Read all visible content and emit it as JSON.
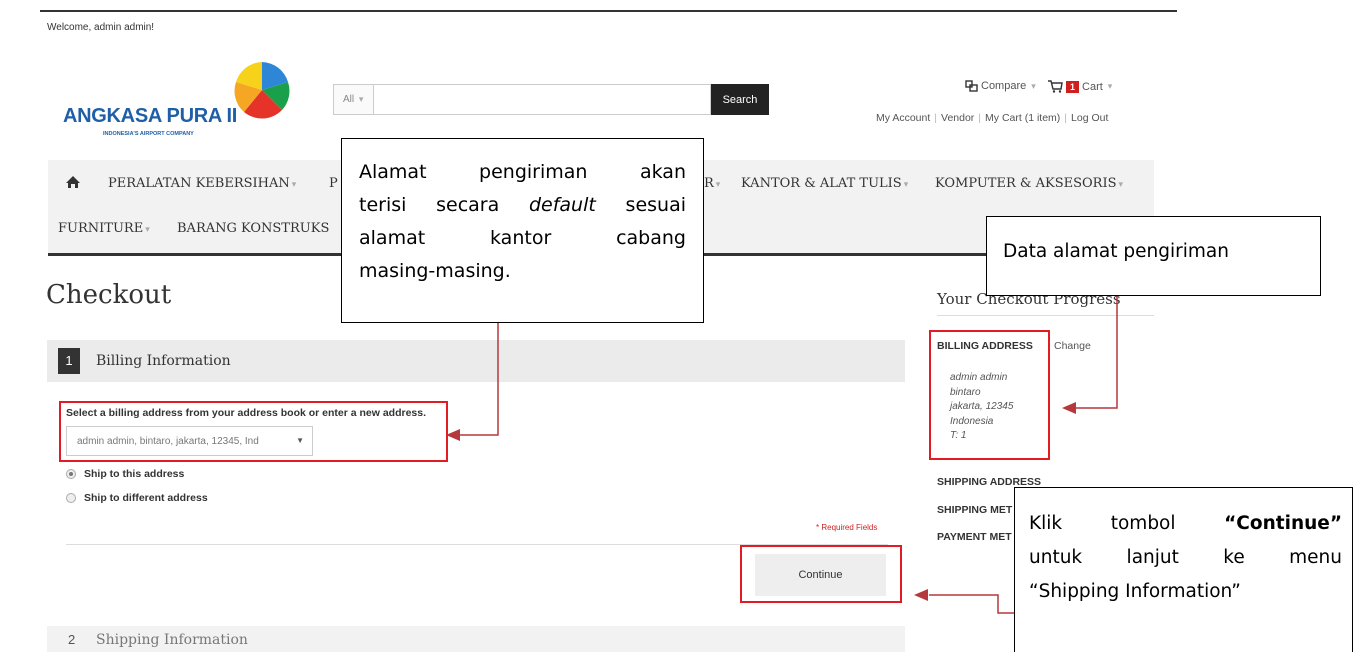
{
  "header": {
    "welcome": "Welcome, admin admin!",
    "logo_text": "ANGKASA PURA II",
    "logo_subtitle": "INDONESIA'S AIRPORT COMPANY",
    "search_category": "All",
    "search_value": "",
    "search_button": "Search",
    "compare_label": "Compare",
    "cart_count": "1",
    "cart_label": "Cart",
    "account_links": [
      "My Account",
      "Vendor",
      "My Cart (1 item)",
      "Log Out"
    ]
  },
  "nav": {
    "row1": [
      "PERALATAN KEBERSIHAN",
      "P",
      "R",
      "KANTOR & ALAT TULIS",
      "KOMPUTER & AKSESORIS"
    ],
    "row2": [
      "FURNITURE",
      "BARANG KONSTRUKS"
    ]
  },
  "checkout": {
    "title": "Checkout",
    "step1_number": "1",
    "step1_title": "Billing Information",
    "select_label": "Select a billing address from your address book or enter a new address.",
    "selected_address": "admin admin, bintaro, jakarta, 12345, Ind",
    "ship_same": "Ship to this address",
    "ship_different": "Ship to different address",
    "required_fields": "* Required Fields",
    "continue_button": "Continue",
    "step2_number": "2",
    "step2_title": "Shipping Information"
  },
  "progress": {
    "title": "Your Checkout Progress",
    "billing_head": "BILLING ADDRESS",
    "change_link": "Change",
    "billing_lines": [
      "admin admin",
      "bintaro",
      "jakarta, 12345",
      "Indonesia",
      "T: 1"
    ],
    "shipping_address_head": "SHIPPING ADDRESS",
    "shipping_method_head": "SHIPPING MET",
    "payment_method_head": "PAYMENT MET"
  },
  "callouts": {
    "c1_lines": [
      "Alamat pengiriman akan",
      "terisi secara",
      "default",
      "sesuai",
      "alamat kantor cabang",
      "masing-masing."
    ],
    "c2": "Data alamat pengiriman",
    "c3_klik": "Klik tombol",
    "c3_bold": "“Continue”",
    "c3_line2": "untuk lanjut ke menu",
    "c3_line3": "“Shipping Information”"
  },
  "colors": {
    "highlight_red": "#e31b23",
    "arrow_red": "#b5383c",
    "logo_blue": "#1f5fa8"
  }
}
